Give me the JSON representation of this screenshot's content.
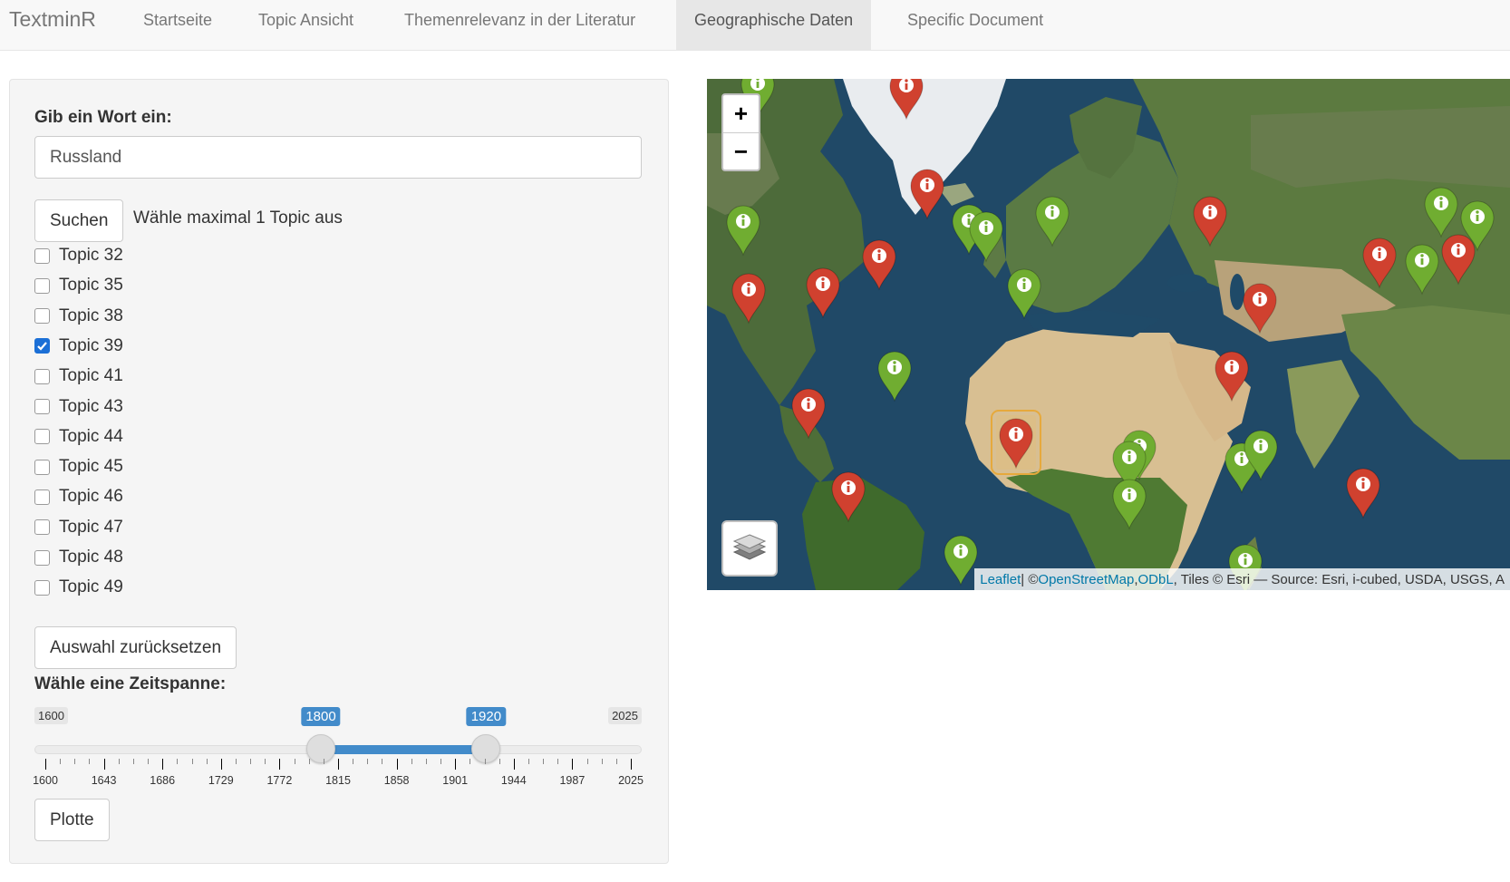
{
  "app": {
    "brand": "TextminR"
  },
  "nav": {
    "tabs": [
      {
        "label": "Startseite",
        "active": false
      },
      {
        "label": "Topic Ansicht",
        "active": false
      },
      {
        "label": "Themenrelevanz in der Literatur",
        "active": false
      },
      {
        "label": "Geographische Daten",
        "active": true
      },
      {
        "label": "Specific Document",
        "active": false
      }
    ]
  },
  "sidebar": {
    "word_label": "Gib ein Wort ein:",
    "word_value": "Russland",
    "search_button": "Suchen",
    "topic_hint": "Wähle maximal 1 Topic aus",
    "topics": [
      {
        "label": "Topic 32",
        "checked": false
      },
      {
        "label": "Topic 35",
        "checked": false
      },
      {
        "label": "Topic 38",
        "checked": false
      },
      {
        "label": "Topic 39",
        "checked": true
      },
      {
        "label": "Topic 41",
        "checked": false
      },
      {
        "label": "Topic 43",
        "checked": false
      },
      {
        "label": "Topic 44",
        "checked": false
      },
      {
        "label": "Topic 45",
        "checked": false
      },
      {
        "label": "Topic 46",
        "checked": false
      },
      {
        "label": "Topic 47",
        "checked": false
      },
      {
        "label": "Topic 48",
        "checked": false
      },
      {
        "label": "Topic 49",
        "checked": false
      }
    ],
    "reset_button": "Auswahl zurücksetzen",
    "timespan_label": "Wähle eine Zeitspanne:",
    "slider": {
      "min": 1600,
      "max": 2025,
      "from": 1800,
      "to": 1920,
      "min_label": "1600",
      "max_label": "2025",
      "from_label": "1800",
      "to_label": "1920",
      "tick_labels": [
        "1600",
        "1643",
        "1686",
        "1729",
        "1772",
        "1815",
        "1858",
        "1901",
        "1944",
        "1987",
        "2025"
      ]
    },
    "plot_button": "Plotte"
  },
  "map": {
    "zoom_in": "+",
    "zoom_out": "−",
    "layers_icon": "layers-icon",
    "attribution": {
      "leaflet": "Leaflet",
      "sep": " | © ",
      "osm": "OpenStreetMap",
      "comma": ", ",
      "odbl": "ODbL",
      "tail": ", Tiles © Esri — Source: Esri, i-cubed, USDA, USGS, A"
    },
    "colors": {
      "red_marker": "#d0412f",
      "green_marker": "#70ad31",
      "ocean": "#1f4a68"
    },
    "marker_count": {
      "red": 17,
      "green": 17
    }
  }
}
